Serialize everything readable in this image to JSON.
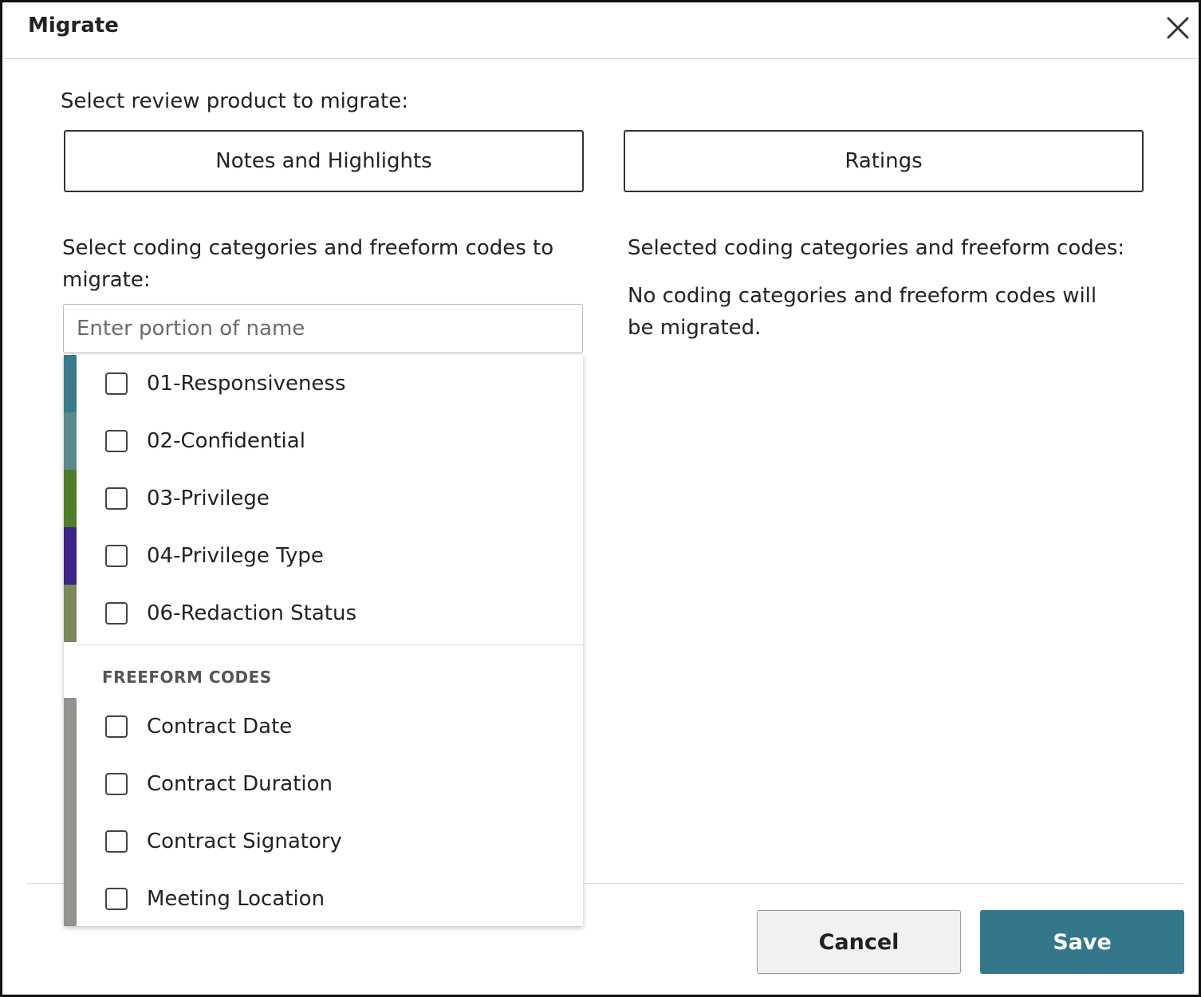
{
  "dialog": {
    "title": "Migrate",
    "close_icon": "close-icon"
  },
  "product": {
    "label": "Select review product to migrate:",
    "options": [
      {
        "label": "Notes and Highlights"
      },
      {
        "label": "Ratings"
      }
    ]
  },
  "categories": {
    "label": "Select coding categories and freeform codes to migrate:",
    "search_placeholder": "Enter portion of name",
    "search_value": "",
    "coding_items": [
      {
        "label": "01-Responsiveness",
        "color": "#3a7a8a",
        "checked": false
      },
      {
        "label": "02-Confidential",
        "color": "#5b8a8c",
        "checked": false
      },
      {
        "label": "03-Privilege",
        "color": "#4f7d2a",
        "checked": false
      },
      {
        "label": "04-Privilege Type",
        "color": "#3c2385",
        "checked": false
      },
      {
        "label": "06-Redaction Status",
        "color": "#7a8a58",
        "checked": false
      }
    ],
    "freeform_heading": "FREEFORM CODES",
    "freeform_color": "#93928d",
    "freeform_items": [
      {
        "label": "Contract Date",
        "checked": false
      },
      {
        "label": "Contract Duration",
        "checked": false
      },
      {
        "label": "Contract Signatory",
        "checked": false
      },
      {
        "label": "Meeting Location",
        "checked": false
      }
    ]
  },
  "selected": {
    "label": "Selected coding categories and freeform codes:",
    "empty_text": "No coding categories and freeform codes will be migrated."
  },
  "footer": {
    "cancel_label": "Cancel",
    "save_label": "Save",
    "save_color": "#34778b"
  }
}
